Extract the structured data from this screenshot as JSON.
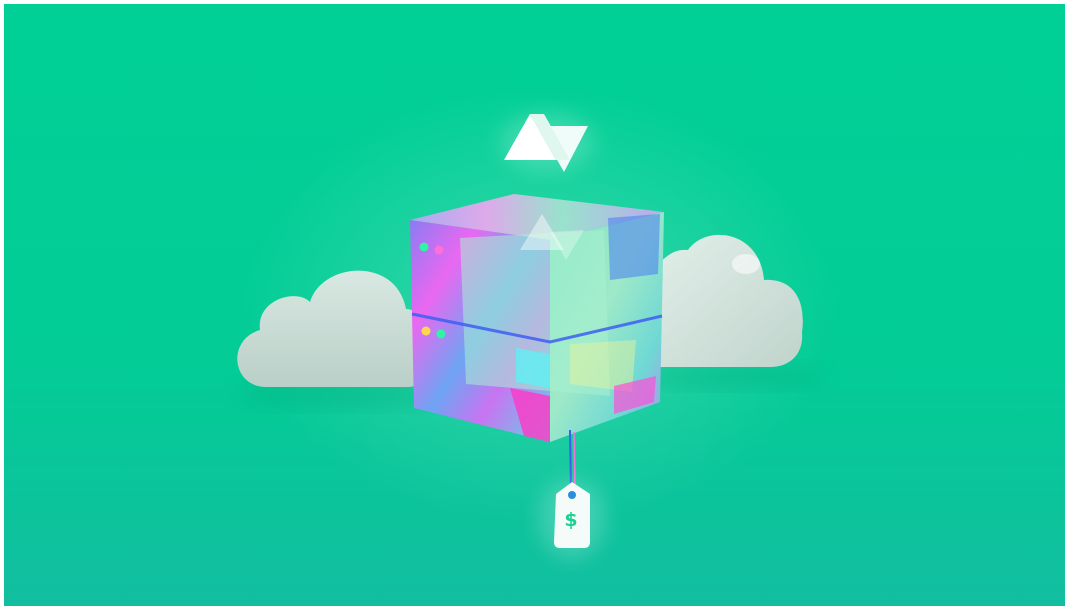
{
  "illustration": {
    "background_color": "#00d095",
    "cloud_color": "#c9ddd6",
    "logo": "triangle-logo-icon",
    "price_tag_symbol": "$",
    "server_led_colors": [
      "#2ef5a6",
      "#ff6fd8",
      "#ffd84f"
    ]
  }
}
